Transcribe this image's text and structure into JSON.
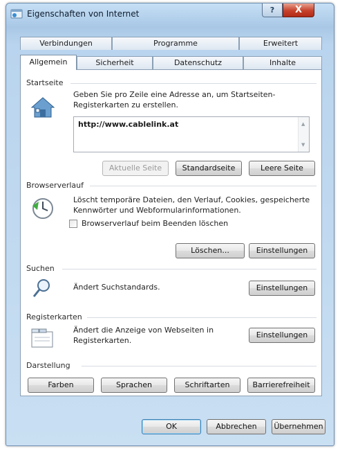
{
  "window": {
    "title": "Eigenschaften von Internet",
    "help_label": "?",
    "close_label": "X"
  },
  "tabs": {
    "row_top": [
      "Verbindungen",
      "Programme",
      "Erweitert"
    ],
    "row_bottom": [
      "Allgemein",
      "Sicherheit",
      "Datenschutz",
      "Inhalte"
    ],
    "active": "Allgemein"
  },
  "startseite": {
    "title": "Startseite",
    "description": "Geben Sie pro Zeile eine Adresse an, um Startseiten-Registerkarten zu erstellen.",
    "url_value": "http://www.cablelink.at",
    "buttons": {
      "aktuelle": "Aktuelle Seite",
      "standard": "Standardseite",
      "leere": "Leere Seite"
    }
  },
  "browserverlauf": {
    "title": "Browserverlauf",
    "description": "Löscht temporäre Dateien, den Verlauf, Cookies, gespeicherte Kennwörter und Webformularinformationen.",
    "checkbox_label": "Browserverlauf beim Beenden löschen",
    "checkbox_checked": false,
    "buttons": {
      "loeschen": "Löschen...",
      "einstellungen": "Einstellungen"
    }
  },
  "suchen": {
    "title": "Suchen",
    "description": "Ändert Suchstandards.",
    "button": "Einstellungen"
  },
  "registerkarten": {
    "title": "Registerkarten",
    "description": "Ändert die Anzeige von Webseiten in Registerkarten.",
    "button": "Einstellungen"
  },
  "darstellung": {
    "title": "Darstellung",
    "buttons": [
      "Farben",
      "Sprachen",
      "Schriftarten",
      "Barrierefreiheit"
    ]
  },
  "footer": {
    "ok": "OK",
    "cancel": "Abbrechen",
    "apply": "Übernehmen"
  }
}
